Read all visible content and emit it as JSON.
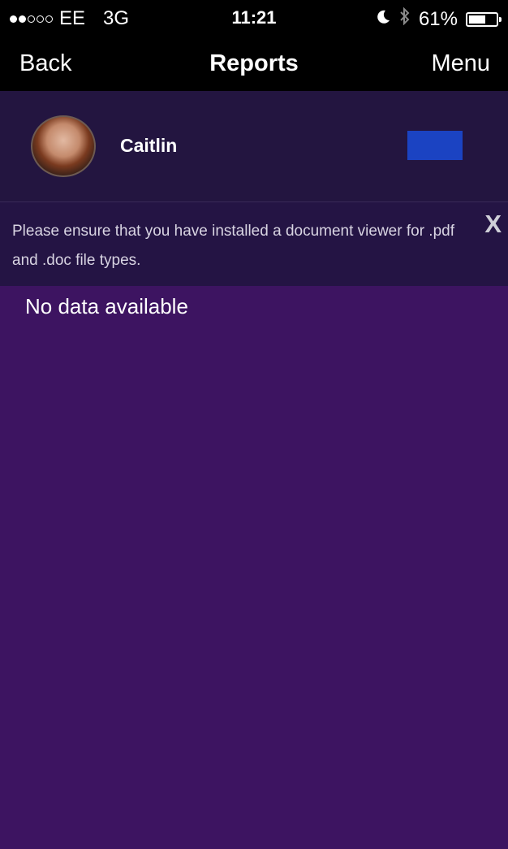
{
  "status_bar": {
    "carrier": "EE",
    "network": "3G",
    "time": "11:21",
    "battery_percent": "61%",
    "battery_level": 0.61,
    "icons": [
      "moon-icon",
      "bluetooth-icon",
      "battery-icon"
    ]
  },
  "nav": {
    "back_label": "Back",
    "title": "Reports",
    "menu_label": "Menu"
  },
  "profile": {
    "name": "Caitlin",
    "logo_text": ""
  },
  "notice": {
    "text": "Please ensure that you have installed a document viewer for .pdf and .doc file types.",
    "close_label": "X"
  },
  "content": {
    "empty_message": "No data available"
  },
  "colors": {
    "background": "#3d1461",
    "header_bar": "#000000",
    "profile_bg": "#231540",
    "notice_bg": "#241444",
    "logo_bg": "#1b43c2"
  }
}
